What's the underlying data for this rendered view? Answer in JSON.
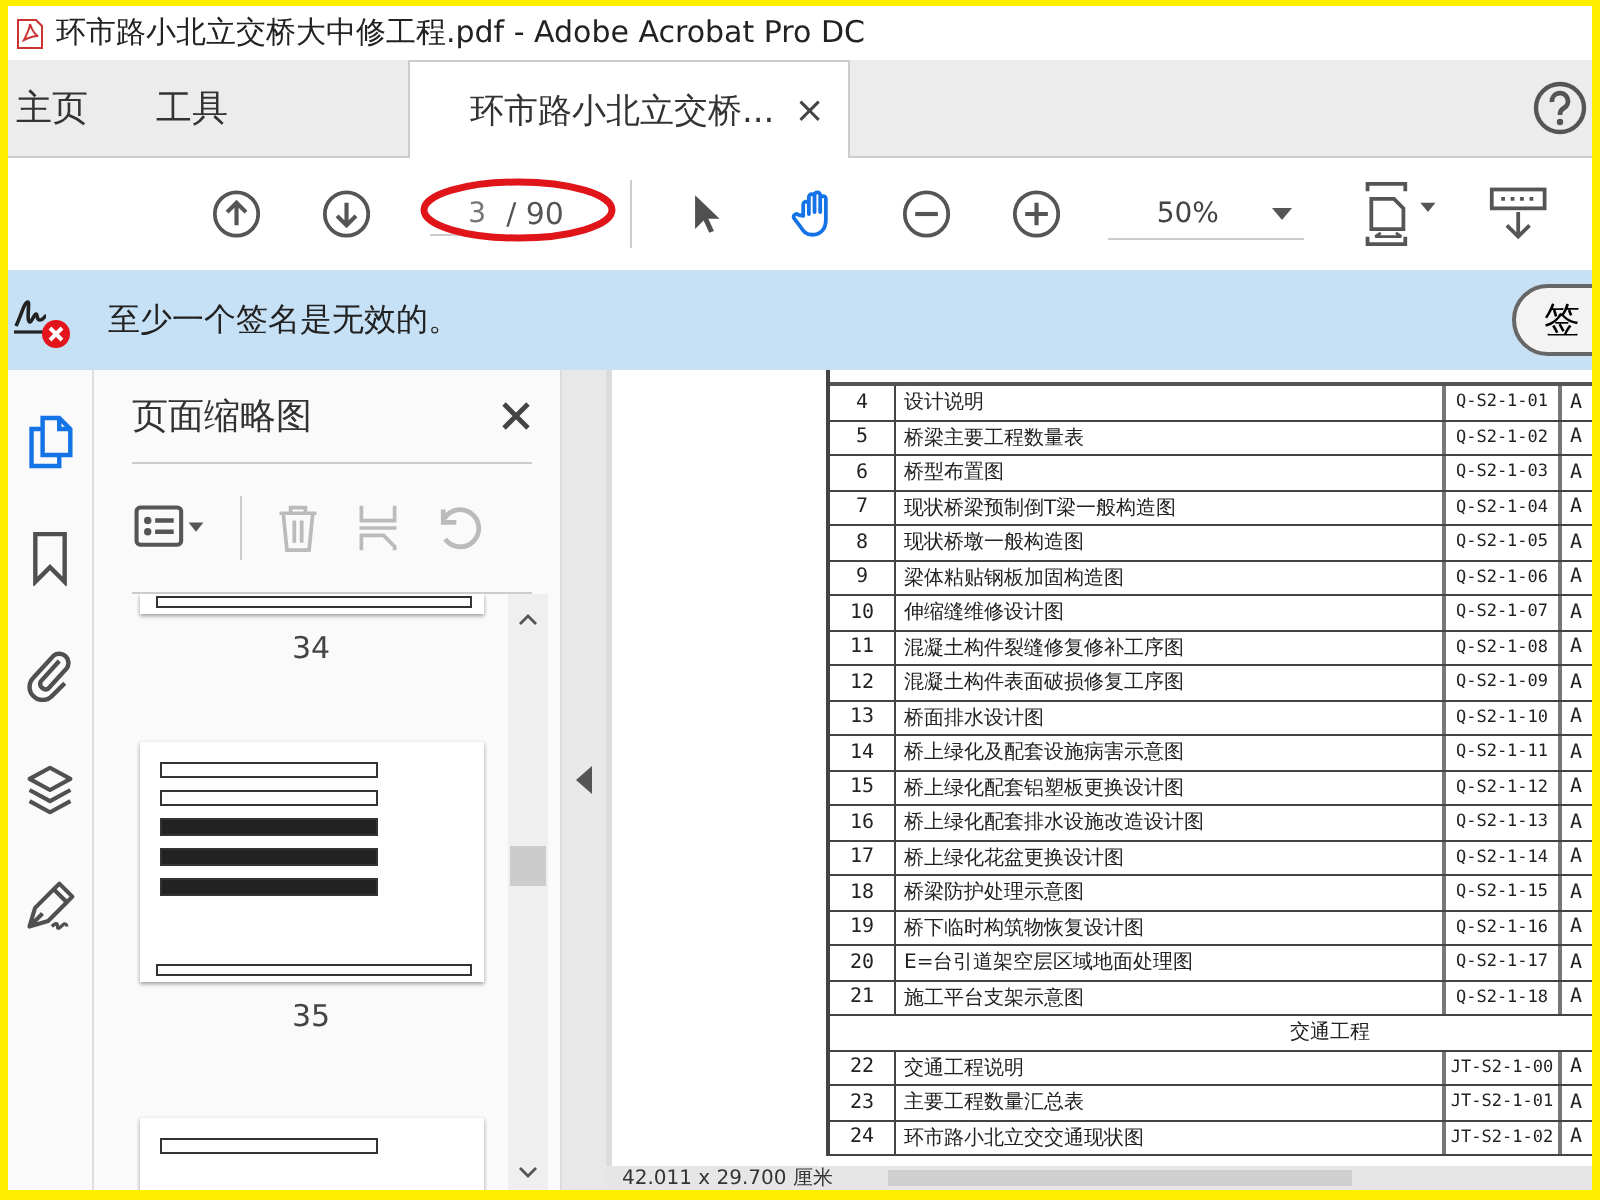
{
  "window": {
    "title": "环市路小北立交桥大中修工程.pdf - Adobe Acrobat Pro DC"
  },
  "tabs": [
    {
      "label": "主页",
      "selected": false
    },
    {
      "label": "工具",
      "selected": false
    },
    {
      "label": "环市路小北立交桥...",
      "selected": true,
      "close": "×"
    }
  ],
  "toolbar": {
    "page_value": "3",
    "page_total": "/ 90",
    "zoom": "50%",
    "tools": [
      {
        "kind": "select",
        "selected": false
      },
      {
        "kind": "hand",
        "selected": true
      }
    ]
  },
  "signature_bar": {
    "message": "至少一个签名是无效的。",
    "button": "签"
  },
  "sidebar": {
    "items": [
      {
        "kind": "pages",
        "selected": true
      },
      {
        "kind": "bookmarks",
        "selected": false
      },
      {
        "kind": "attachments",
        "selected": false
      },
      {
        "kind": "layers",
        "selected": false
      },
      {
        "kind": "signatures",
        "selected": false
      }
    ]
  },
  "thumbnails_panel": {
    "title": "页面缩略图",
    "thumbnails": [
      {
        "kind": "cropped_top",
        "label": "34"
      },
      {
        "kind": "full",
        "label": "35"
      },
      {
        "kind": "cropped_bottom"
      }
    ]
  },
  "document": {
    "dimensions": "42.011 x 29.700 厘米",
    "rows": [
      {
        "kind": "item",
        "number": "4",
        "title": "设计说明",
        "code": "Q-S2-1-01",
        "column_4": "A"
      },
      {
        "kind": "item",
        "number": "5",
        "title": "桥梁主要工程数量表",
        "code": "Q-S2-1-02",
        "column_4": "A"
      },
      {
        "kind": "item",
        "number": "6",
        "title": "桥型布置图",
        "code": "Q-S2-1-03",
        "column_4": "A"
      },
      {
        "kind": "item",
        "number": "7",
        "title": "现状桥梁预制倒T梁一般构造图",
        "code": "Q-S2-1-04",
        "column_4": "A"
      },
      {
        "kind": "item",
        "number": "8",
        "title": "现状桥墩一般构造图",
        "code": "Q-S2-1-05",
        "column_4": "A"
      },
      {
        "kind": "item",
        "number": "9",
        "title": "梁体粘贴钢板加固构造图",
        "code": "Q-S2-1-06",
        "column_4": "A"
      },
      {
        "kind": "item",
        "number": "10",
        "title": "伸缩缝维修设计图",
        "code": "Q-S2-1-07",
        "column_4": "A"
      },
      {
        "kind": "item",
        "number": "11",
        "title": "混凝土构件裂缝修复修补工序图",
        "code": "Q-S2-1-08",
        "column_4": "A"
      },
      {
        "kind": "item",
        "number": "12",
        "title": "混凝土构件表面破损修复工序图",
        "code": "Q-S2-1-09",
        "column_4": "A"
      },
      {
        "kind": "item",
        "number": "13",
        "title": "桥面排水设计图",
        "code": "Q-S2-1-10",
        "column_4": "A"
      },
      {
        "kind": "item",
        "number": "14",
        "title": "桥上绿化及配套设施病害示意图",
        "code": "Q-S2-1-11",
        "column_4": "A"
      },
      {
        "kind": "item",
        "number": "15",
        "title": "桥上绿化配套铝塑板更换设计图",
        "code": "Q-S2-1-12",
        "column_4": "A"
      },
      {
        "kind": "item",
        "number": "16",
        "title": "桥上绿化配套排水设施改造设计图",
        "code": "Q-S2-1-13",
        "column_4": "A"
      },
      {
        "kind": "item",
        "number": "17",
        "title": "桥上绿化花盆更换设计图",
        "code": "Q-S2-1-14",
        "column_4": "A"
      },
      {
        "kind": "item",
        "number": "18",
        "title": "桥梁防护处理示意图",
        "code": "Q-S2-1-15",
        "column_4": "A"
      },
      {
        "kind": "item",
        "number": "19",
        "title": "桥下临时构筑物恢复设计图",
        "code": "Q-S2-1-16",
        "column_4": "A"
      },
      {
        "kind": "item",
        "number": "20",
        "title": "E=台引道架空层区域地面处理图",
        "code": "Q-S2-1-17",
        "column_4": "A"
      },
      {
        "kind": "item",
        "number": "21",
        "title": "施工平台支架示意图",
        "code": "Q-S2-1-18",
        "column_4": "A"
      },
      {
        "kind": "section",
        "title": "交通工程"
      },
      {
        "kind": "item",
        "number": "22",
        "title": "交通工程说明",
        "code": "JT-S2-1-00",
        "column_4": "A"
      },
      {
        "kind": "item",
        "number": "23",
        "title": "主要工程数量汇总表",
        "code": "JT-S2-1-01",
        "column_4": "A"
      },
      {
        "kind": "item",
        "number": "24",
        "title": "环市路小北立交交通现状图",
        "code": "JT-S2-1-02",
        "column_4": "A"
      }
    ]
  }
}
